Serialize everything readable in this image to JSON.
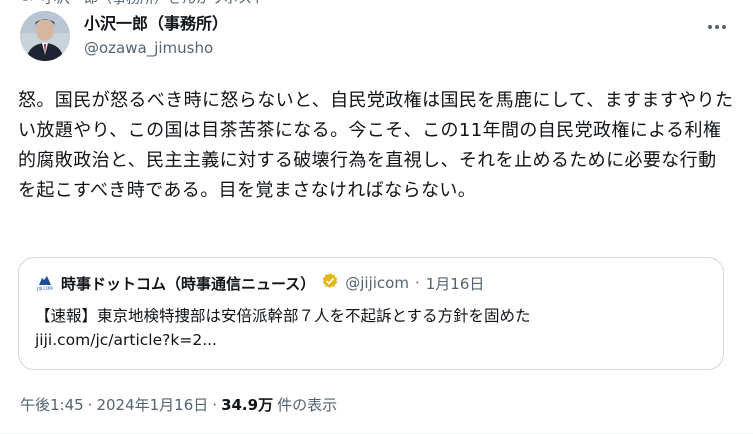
{
  "repost": {
    "text": "小沢一郎（事務所）さんがリポスト"
  },
  "author": {
    "name": "小沢一郎（事務所）",
    "handle": "@ozawa_jimusho"
  },
  "tweet": {
    "text": "怒。国民が怒るべき時に怒らないと、自民党政権は国民を馬鹿にして、ますますやりたい放題やり、この国は目茶苦茶になる。今こそ、この11年間の自民党政権による利権的腐敗政治と、民主主義に対する破壊行為を直視し、それを止めるために必要な行動を起こすべき時である。目を覚まさなければならない。"
  },
  "quote": {
    "logo_text": "JIJI.COM",
    "name": "時事ドットコム（時事通信ニュース）",
    "handle": "@jijicom",
    "separator": "·",
    "date": "1月16日",
    "line1": "【速報】東京地検特捜部は安倍派幹部７人を不起訴とする方針を固めた",
    "line2": "jiji.com/jc/article?k=2..."
  },
  "footer": {
    "time": "午後1:45",
    "sep1": "·",
    "date": "2024年1月16日",
    "sep2": "·",
    "views": "34.9万",
    "views_label": "件の表示"
  },
  "colors": {
    "text": "#0f1419",
    "muted": "#536471",
    "border": "#cfd9de",
    "verified": "#e2b719"
  },
  "icons": [
    "repost-icon",
    "more-options-icon",
    "jiji-logo",
    "verified-badge-icon"
  ]
}
